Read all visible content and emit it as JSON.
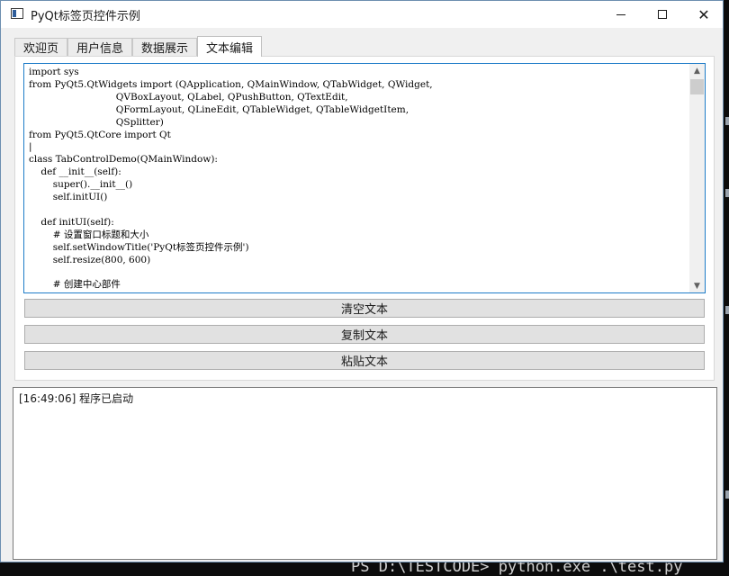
{
  "window": {
    "title": "PyQt标签页控件示例"
  },
  "tabs": [
    {
      "label": "欢迎页"
    },
    {
      "label": "用户信息"
    },
    {
      "label": "数据展示"
    },
    {
      "label": "文本编辑",
      "active": true
    }
  ],
  "editor": {
    "content": "import sys\nfrom PyQt5.QtWidgets import (QApplication, QMainWindow, QTabWidget, QWidget,\n                             QVBoxLayout, QLabel, QPushButton, QTextEdit,\n                             QFormLayout, QLineEdit, QTableWidget, QTableWidgetItem,\n                             QSplitter)\nfrom PyQt5.QtCore import Qt\n|\nclass TabControlDemo(QMainWindow):\n    def __init__(self):\n        super().__init__()\n        self.initUI()\n\n    def initUI(self):\n        # 设置窗口标题和大小\n        self.setWindowTitle('PyQt标签页控件示例')\n        self.resize(800, 600)\n\n        # 创建中心部件"
  },
  "buttons": {
    "clear": "清空文本",
    "copy": "复制文本",
    "paste": "粘贴文本"
  },
  "log": {
    "line": "[16:49:06] 程序已启动"
  },
  "terminal": {
    "prompt": "PS D:\\TESTCODE> python.exe .\\test.py"
  },
  "colors": {
    "focus_border": "#1e7cc8",
    "window_bg": "#f0f0f0",
    "terminal_bg": "#0c0c0c"
  },
  "icons": {
    "app": "window-icon",
    "minimize": "minimize-icon",
    "maximize": "maximize-icon",
    "close": "close-icon",
    "scroll_up": "chevron-up-icon",
    "scroll_down": "chevron-down-icon"
  }
}
